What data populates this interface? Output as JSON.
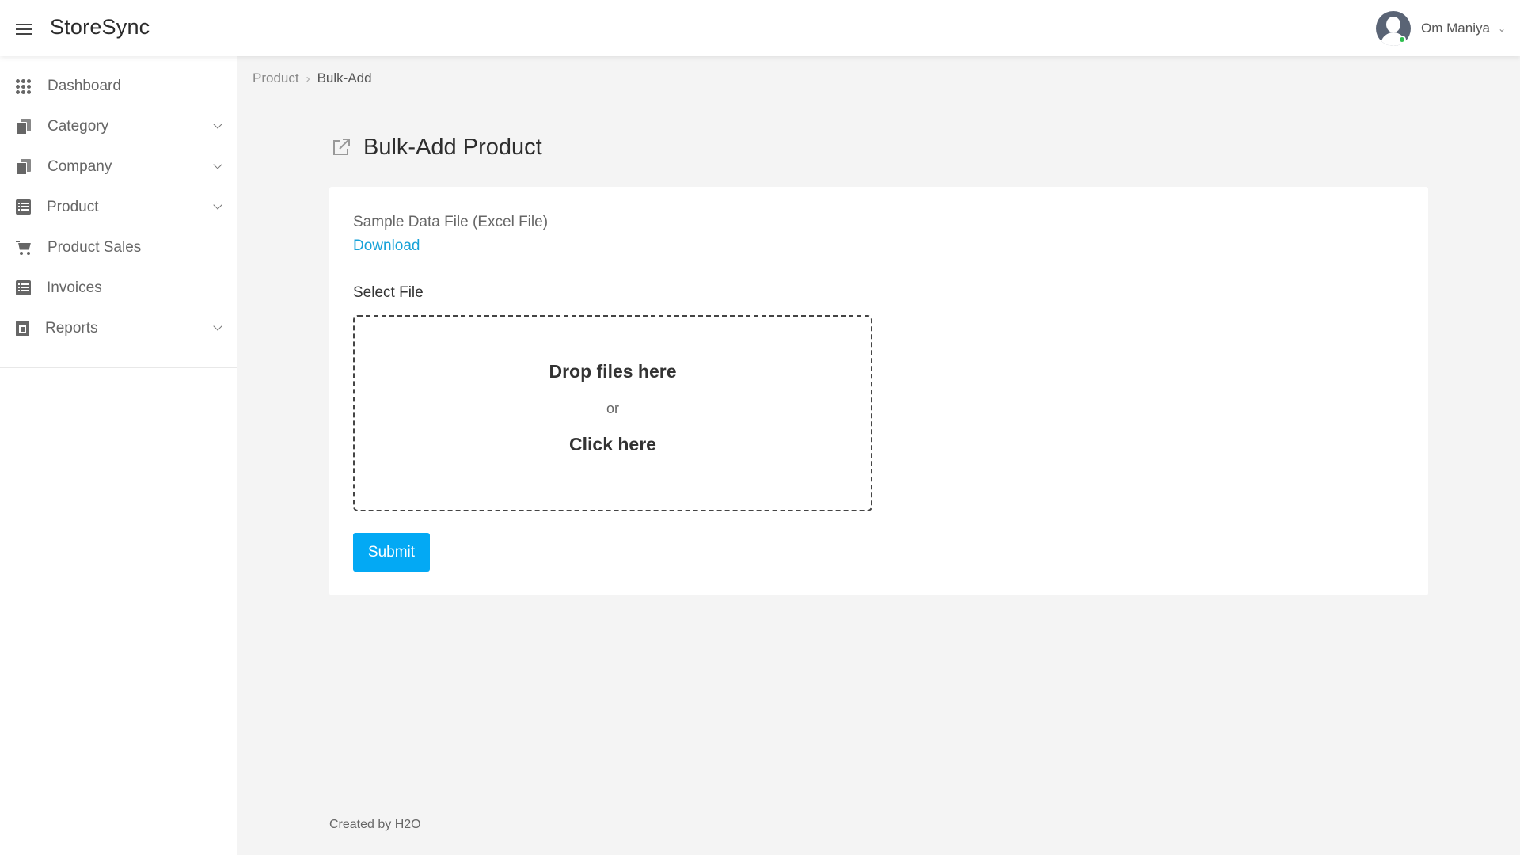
{
  "header": {
    "brand": "StoreSync",
    "user_name": "Om Maniya",
    "user_caret": "⌄",
    "menu_icon": "hamburger-icon",
    "avatar_icon": "user-avatar-icon",
    "status_color": "#2fbf4f"
  },
  "sidebar": {
    "items": [
      {
        "label": "Dashboard",
        "icon": "grid-icon",
        "has_submenu": false
      },
      {
        "label": "Category",
        "icon": "document-icon",
        "has_submenu": true
      },
      {
        "label": "Company",
        "icon": "document-icon",
        "has_submenu": true
      },
      {
        "label": "Product",
        "icon": "list-icon",
        "has_submenu": true
      },
      {
        "label": "Product Sales",
        "icon": "cart-icon",
        "has_submenu": false
      },
      {
        "label": "Invoices",
        "icon": "list-icon",
        "has_submenu": false
      },
      {
        "label": "Reports",
        "icon": "report-icon",
        "has_submenu": true
      }
    ]
  },
  "breadcrumb": {
    "parent": "Product",
    "separator": "›",
    "current": "Bulk-Add"
  },
  "page": {
    "title": "Bulk-Add Product",
    "title_icon": "external-link-icon"
  },
  "form": {
    "sample_label": "Sample Data File (Excel File)",
    "download_label": "Download",
    "select_label": "Select File",
    "dropzone": {
      "title": "Drop files here",
      "or": "or",
      "click": "Click here"
    },
    "submit_label": "Submit"
  },
  "footer": {
    "text": "Created by H2O"
  },
  "colors": {
    "accent": "#03a9f4",
    "link": "#17a2d8",
    "background": "#f4f4f4"
  }
}
